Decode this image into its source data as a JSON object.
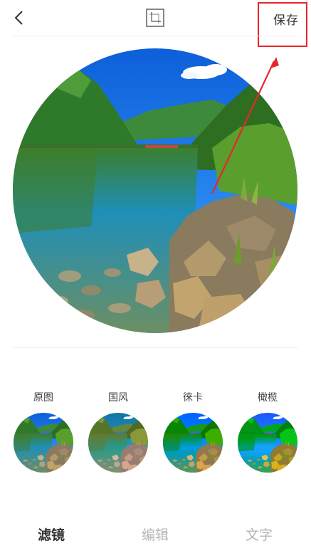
{
  "topbar": {
    "back_icon": "chevron-left-icon",
    "crop_icon": "crop-frame-icon",
    "save_label": "保存"
  },
  "filters": [
    {
      "label": "原图",
      "tone": "original"
    },
    {
      "label": "国风",
      "tone": "teal"
    },
    {
      "label": "徕卡",
      "tone": "vivid-blue"
    },
    {
      "label": "橄榄",
      "tone": "deep-blue"
    }
  ],
  "tabs": [
    {
      "label": "滤镜",
      "active": true
    },
    {
      "label": "编辑",
      "active": false
    },
    {
      "label": "文字",
      "active": false
    }
  ],
  "colors": {
    "highlight": "#e8262a",
    "active_tab": "#333333",
    "inactive_tab": "#b5b5b5"
  }
}
